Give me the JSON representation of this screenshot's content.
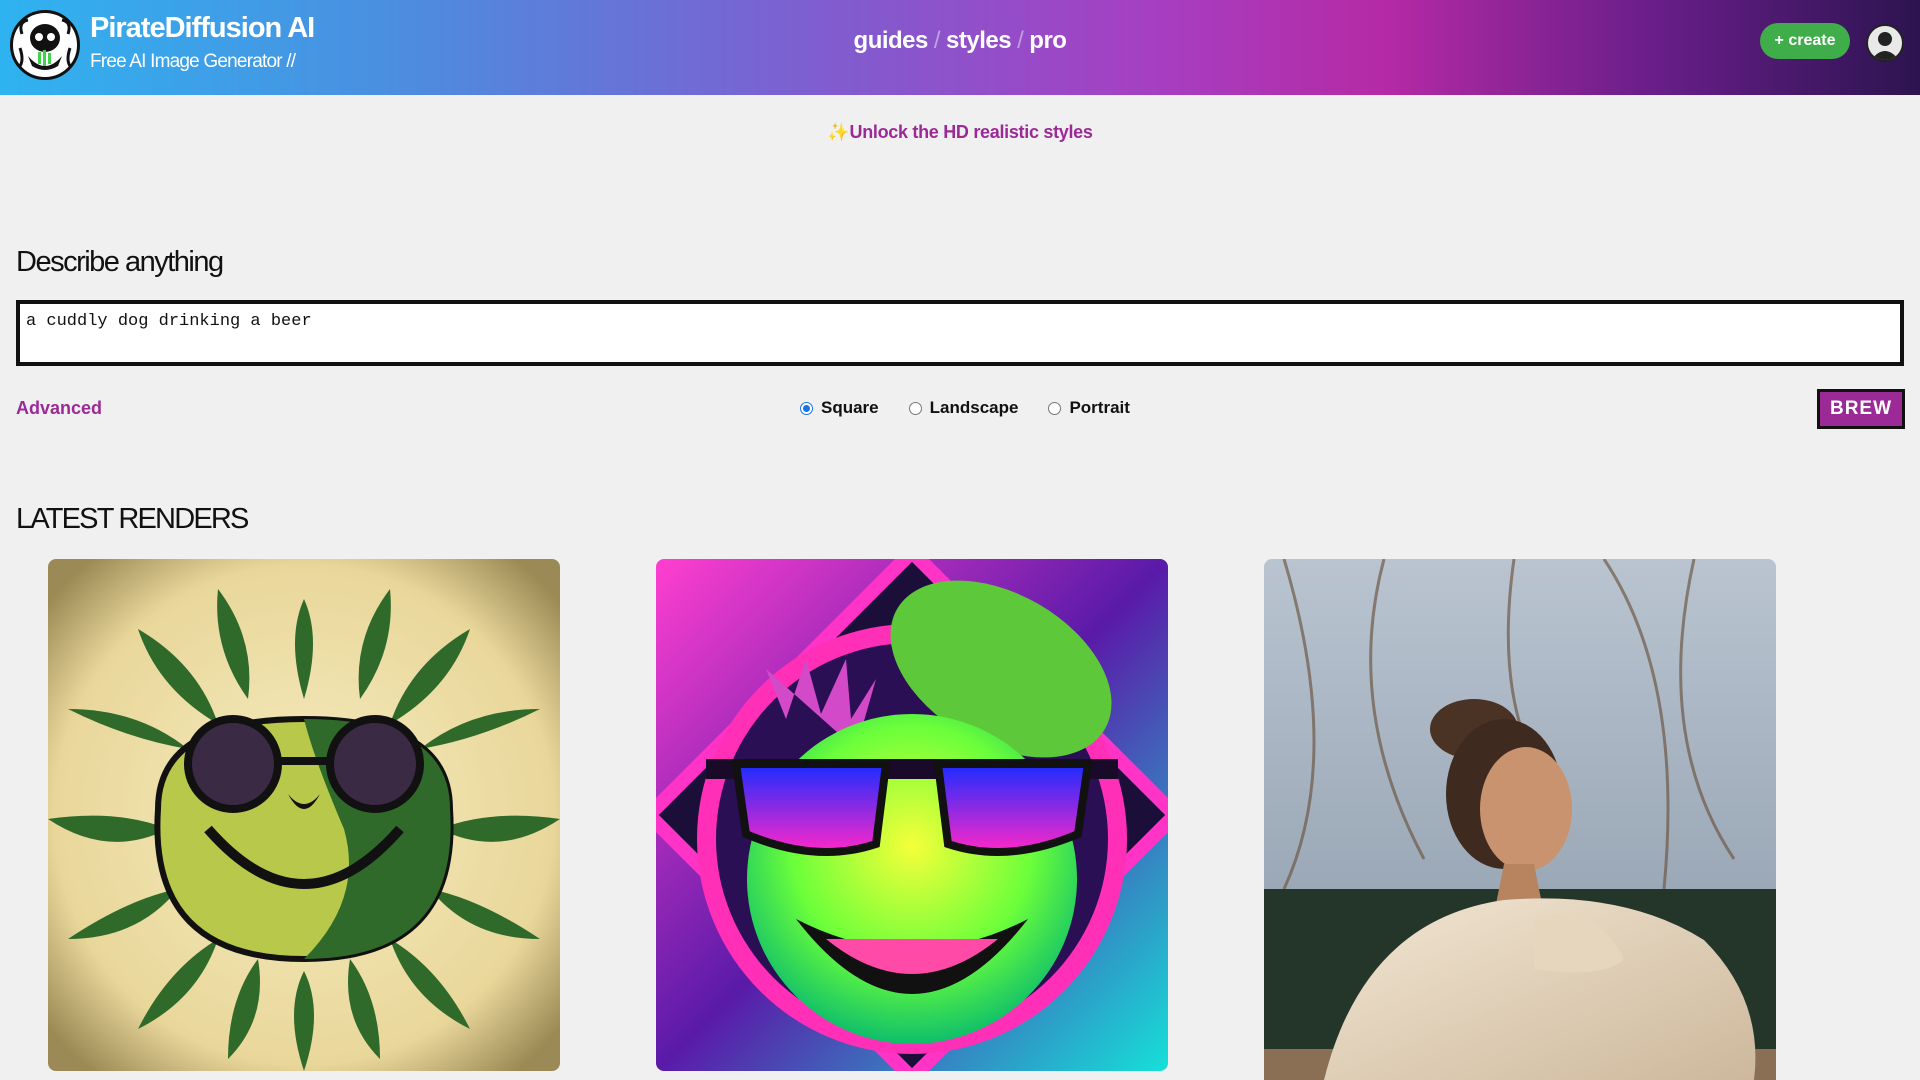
{
  "header": {
    "brand_title": "PirateDiffusion AI",
    "brand_subtitle": "Free AI Image Generator //",
    "nav": [
      {
        "label": "guides"
      },
      {
        "label": "styles"
      },
      {
        "label": "pro"
      }
    ],
    "nav_separator": "/",
    "create_label": "+ create",
    "logo_icon": "pirate-skull-logo-icon",
    "avatar_icon": "user-avatar-icon"
  },
  "promo": {
    "sparkle": "✨",
    "text": "Unlock the HD realistic styles"
  },
  "prompt": {
    "heading": "Describe anything",
    "value": "a cuddly dog drinking a beer"
  },
  "controls": {
    "advanced_label": "Advanced",
    "orientations": [
      {
        "label": "Square",
        "selected": true
      },
      {
        "label": "Landscape",
        "selected": false
      },
      {
        "label": "Portrait",
        "selected": false
      }
    ],
    "brew_label": "BREW"
  },
  "latest": {
    "heading": "LATEST RENDERS"
  },
  "colors": {
    "accent": "#9b2a97",
    "create_green": "#3fae4a",
    "radio_blue": "#1a73e8"
  }
}
